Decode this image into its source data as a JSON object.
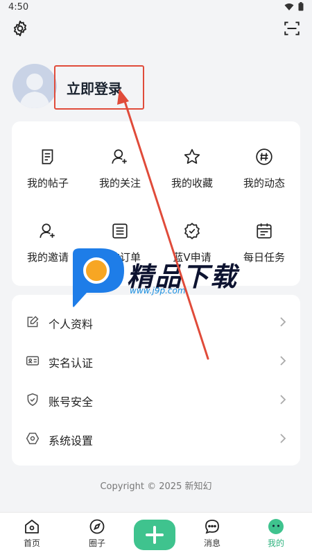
{
  "status_bar": {
    "time": "4:50"
  },
  "profile": {
    "login_label": "立即登录"
  },
  "grid": [
    {
      "label": "我的帖子",
      "icon": "post-icon"
    },
    {
      "label": "我的关注",
      "icon": "follow-icon"
    },
    {
      "label": "我的收藏",
      "icon": "star-icon"
    },
    {
      "label": "我的动态",
      "icon": "hash-icon"
    },
    {
      "label": "我的邀请",
      "icon": "invite-icon"
    },
    {
      "label": "我的订单",
      "icon": "order-icon"
    },
    {
      "label": "蓝V申请",
      "icon": "badge-icon"
    },
    {
      "label": "每日任务",
      "icon": "calendar-icon"
    }
  ],
  "list": [
    {
      "label": "个人资料",
      "icon": "edit-icon"
    },
    {
      "label": "实名认证",
      "icon": "id-card-icon"
    },
    {
      "label": "账号安全",
      "icon": "shield-icon"
    },
    {
      "label": "系统设置",
      "icon": "hexagon-settings-icon"
    }
  ],
  "copyright": "Copyright © 2025 新知幻",
  "tabs": [
    {
      "label": "首页",
      "icon": "home-icon"
    },
    {
      "label": "圈子",
      "icon": "compass-icon"
    },
    {
      "label": "消息",
      "icon": "message-icon"
    },
    {
      "label": "我的",
      "icon": "profile-face-icon"
    }
  ],
  "watermark": {
    "title": "精品下载",
    "url": "www.j9p.com"
  },
  "colors": {
    "accent": "#3fc38e",
    "annotation": "#e04b3a",
    "background": "#f3f4f6"
  }
}
